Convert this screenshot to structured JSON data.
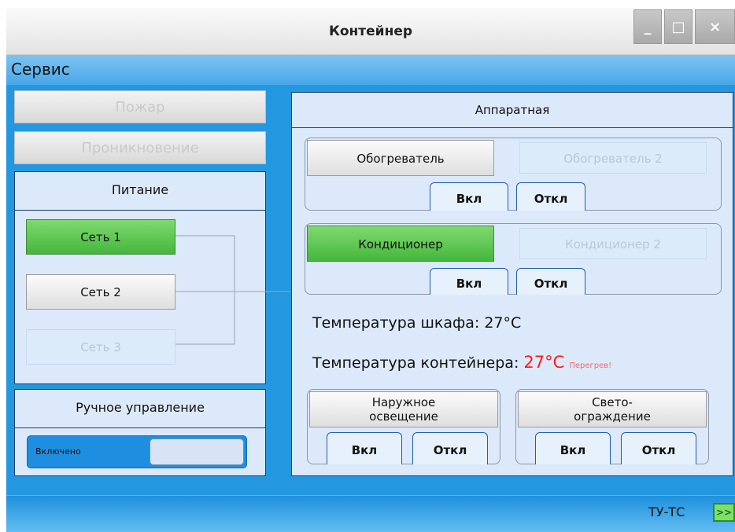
{
  "window": {
    "title": "Контейнер",
    "controls": {
      "minimize": "_",
      "maximize": "□",
      "close": "×"
    }
  },
  "menu": {
    "service": "Сервис"
  },
  "left": {
    "fire_button": "Пожар",
    "intrusion_button": "Проникновение",
    "power": {
      "title": "Питание",
      "net1": "Сеть 1",
      "net2": "Сеть 2",
      "net3": "Сеть 3"
    },
    "manual": {
      "title": "Ручное управление",
      "toggle_label": "Включено"
    }
  },
  "hardware": {
    "title": "Аппаратная",
    "heater": {
      "button1": "Обогреватель",
      "button2": "Обогреватель 2",
      "on": "Вкл",
      "off": "Откл"
    },
    "conditioner": {
      "button1": "Кондиционер",
      "button2": "Кондиционер 2",
      "on": "Вкл",
      "off": "Откл"
    },
    "cabinet_temp_label": "Температура шкафа:",
    "cabinet_temp_value": "27°C",
    "container_temp_label": "Температура контейнера:",
    "container_temp_value": "27°C",
    "overheat": "Перегрев!",
    "outdoor_light": {
      "line1": "Наружное",
      "line2": "освещение",
      "on": "Вкл",
      "off": "Откл"
    },
    "obstruction_light": {
      "line1": "Свето-",
      "line2": "ограждение",
      "on": "Вкл",
      "off": "Откл"
    }
  },
  "status": {
    "label": "ТУ-ТС",
    "icon_text": ">>"
  },
  "colors": {
    "active_green": "#45b73d",
    "alert_red": "#ff1a1a",
    "window_blue": "#2398e0"
  }
}
